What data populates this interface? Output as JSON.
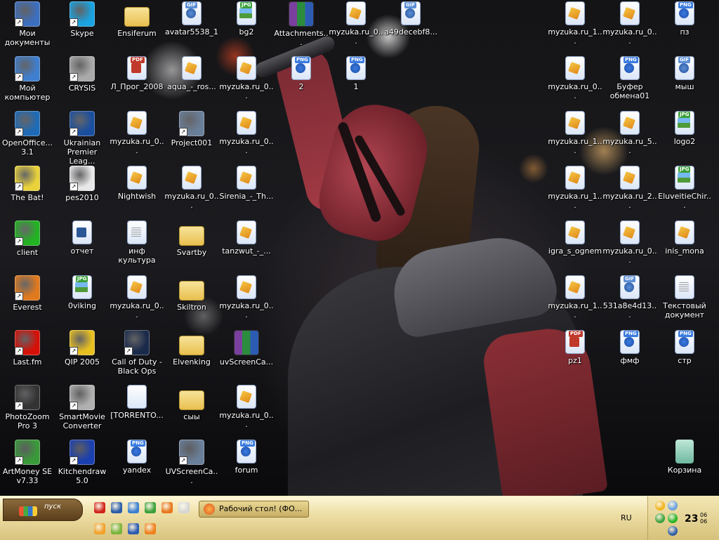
{
  "desktop": {
    "icons": [
      {
        "label": "Мои документы",
        "type": "app",
        "color": "#3c6fbf",
        "name": "my-documents"
      },
      {
        "label": "Skype",
        "type": "app",
        "color": "#1aa3e0",
        "name": "skype"
      },
      {
        "label": "Ensiferum",
        "type": "folder",
        "color": "#e9c04f",
        "name": "ensiferum"
      },
      {
        "label": "avatar5538_1",
        "type": "gif",
        "ext": "GIF",
        "color": "#5c8fd6",
        "name": "avatar5538"
      },
      {
        "label": "bg2",
        "type": "jpg",
        "ext": "JPG",
        "color": "#3aa03a",
        "name": "bg2"
      },
      {
        "label": "Attachments...",
        "type": "rar",
        "color": "#7b3f9e",
        "name": "attachments"
      },
      {
        "label": "myzuka.ru_0...",
        "type": "audio",
        "color": "#f5c542",
        "name": "myzuka-1"
      },
      {
        "label": "a49decebf8...",
        "type": "gif",
        "ext": "GIF",
        "color": "#5c8fd6",
        "name": "a49decebf8"
      },
      {
        "label": "myzuka.ru_1...",
        "type": "audio",
        "color": "#f5c542",
        "name": "myzuka-2"
      },
      {
        "label": "myzuka.ru_0...",
        "type": "audio",
        "color": "#f5c542",
        "name": "myzuka-3"
      },
      {
        "label": "пз",
        "type": "png",
        "ext": "PNG",
        "color": "#3a7be0",
        "name": "pz"
      },
      {
        "label": "Мой компьютер",
        "type": "app",
        "color": "#3f7fd0",
        "name": "my-computer"
      },
      {
        "label": "CRYSIS",
        "type": "app",
        "color": "#aaaaaa",
        "name": "crysis"
      },
      {
        "label": "Л_Прог_2008",
        "type": "pdf",
        "ext": "PDF",
        "color": "#c0392b",
        "name": "l-prog-2008"
      },
      {
        "label": "aqua_-_ros...",
        "type": "audio",
        "color": "#f5c542",
        "name": "aqua-ros"
      },
      {
        "label": "myzuka.ru_0...",
        "type": "audio",
        "color": "#f5c542",
        "name": "myzuka-4"
      },
      {
        "label": "2",
        "type": "png",
        "ext": "PNG",
        "color": "#3a7be0",
        "name": "png-2"
      },
      {
        "label": "1",
        "type": "png",
        "ext": "PNG",
        "color": "#3a7be0",
        "name": "png-1"
      },
      {
        "label": "myzuka.ru_0...",
        "type": "audio",
        "color": "#f5c542",
        "name": "myzuka-5"
      },
      {
        "label": "Буфер обмена01",
        "type": "png",
        "ext": "PNG",
        "color": "#3a7be0",
        "name": "buffer-01"
      },
      {
        "label": "мыш",
        "type": "gif",
        "ext": "GIF",
        "color": "#5c8fd6",
        "name": "mysh"
      },
      {
        "label": "OpenOffice... 3.1",
        "type": "app",
        "color": "#1e6bb8",
        "name": "openoffice"
      },
      {
        "label": "Ukrainian Premier Leag...",
        "type": "app",
        "color": "#1a4fa0",
        "name": "ukrainian-premier-league"
      },
      {
        "label": "myzuka.ru_0...",
        "type": "audio",
        "color": "#f5c542",
        "name": "myzuka-6"
      },
      {
        "label": "Project001",
        "type": "app",
        "color": "#6a7f99",
        "name": "project001"
      },
      {
        "label": "myzuka.ru_0...",
        "type": "audio",
        "color": "#f5c542",
        "name": "myzuka-7"
      },
      {
        "label": "myzuka.ru_1...",
        "type": "audio",
        "color": "#f5c542",
        "name": "myzuka-8"
      },
      {
        "label": "myzuka.ru_5...",
        "type": "audio",
        "color": "#f5c542",
        "name": "myzuka-9"
      },
      {
        "label": "logo2",
        "type": "jpg",
        "ext": "JPG",
        "color": "#3aa03a",
        "name": "logo2"
      },
      {
        "label": "The Bat!",
        "type": "app",
        "color": "#e9d23a",
        "name": "the-bat"
      },
      {
        "label": "pes2010",
        "type": "app",
        "color": "#e8e8e8",
        "name": "pes2010"
      },
      {
        "label": "Nightwish",
        "type": "audio",
        "color": "#f5c542",
        "name": "nightwish"
      },
      {
        "label": "myzuka.ru_0...",
        "type": "audio",
        "color": "#f5c542",
        "name": "myzuka-10"
      },
      {
        "label": "Sirenia_-_Th...",
        "type": "audio",
        "color": "#f5c542",
        "name": "sirenia"
      },
      {
        "label": "myzuka.ru_1...",
        "type": "audio",
        "color": "#f5c542",
        "name": "myzuka-11"
      },
      {
        "label": "myzuka.ru_2...",
        "type": "audio",
        "color": "#f5c542",
        "name": "myzuka-12"
      },
      {
        "label": "EluveitieChir...",
        "type": "jpg",
        "ext": "JPG",
        "color": "#3aa03a",
        "name": "eluveitie"
      },
      {
        "label": "client",
        "type": "app",
        "color": "#22b322",
        "name": "client"
      },
      {
        "label": "отчет",
        "type": "doc",
        "color": "#2b5797",
        "name": "otchet"
      },
      {
        "label": "инф культура",
        "type": "txt",
        "color": "#999999",
        "name": "inf-kultura"
      },
      {
        "label": "Svartby",
        "type": "folder",
        "color": "#e9c04f",
        "name": "svartby"
      },
      {
        "label": "tanzwut_-_...",
        "type": "audio",
        "color": "#f5c542",
        "name": "tanzwut"
      },
      {
        "label": "igra_s_ognem",
        "type": "audio",
        "color": "#f5c542",
        "name": "igra-s-ognem"
      },
      {
        "label": "myzuka.ru_0...",
        "type": "audio",
        "color": "#f5c542",
        "name": "myzuka-13"
      },
      {
        "label": "inis_mona",
        "type": "audio",
        "color": "#f5c542",
        "name": "inis-mona"
      },
      {
        "label": "Everest",
        "type": "app",
        "color": "#e07a1e",
        "name": "everest"
      },
      {
        "label": "0viking",
        "type": "jpg",
        "ext": "JPG",
        "color": "#3aa03a",
        "name": "0viking"
      },
      {
        "label": "myzuka.ru_0...",
        "type": "audio",
        "color": "#f5c542",
        "name": "myzuka-14"
      },
      {
        "label": "Skiltron",
        "type": "folder",
        "color": "#e9c04f",
        "name": "skiltron"
      },
      {
        "label": "myzuka.ru_0...",
        "type": "audio",
        "color": "#f5c542",
        "name": "myzuka-15"
      },
      {
        "label": "myzuka.ru_1...",
        "type": "audio",
        "color": "#f5c542",
        "name": "myzuka-16"
      },
      {
        "label": "531a8e4d13...",
        "type": "gif",
        "ext": "GIF",
        "color": "#5c8fd6",
        "name": "531a8e4d13"
      },
      {
        "label": "Текстовый документ",
        "type": "txt",
        "color": "#999999",
        "name": "text-document"
      },
      {
        "label": "Last.fm",
        "type": "app",
        "color": "#d51007",
        "name": "lastfm"
      },
      {
        "label": "QIP 2005",
        "type": "app",
        "color": "#e8c020",
        "name": "qip-2005"
      },
      {
        "label": "Call of Duty - Black Ops",
        "type": "app",
        "color": "#1a2a4a",
        "name": "call-of-duty"
      },
      {
        "label": "Elvenking",
        "type": "folder",
        "color": "#e9c04f",
        "name": "elvenking"
      },
      {
        "label": "uvScreenCa...",
        "type": "rar",
        "color": "#7b3f9e",
        "name": "uvscreencamera-rar"
      },
      {
        "label": "pz1",
        "type": "pdf",
        "ext": "PDF",
        "color": "#c0392b",
        "name": "pz1"
      },
      {
        "label": "фмф",
        "type": "png",
        "ext": "PNG",
        "color": "#3a7be0",
        "name": "fmf"
      },
      {
        "label": "стр",
        "type": "png",
        "ext": "PNG",
        "color": "#3a7be0",
        "name": "str"
      },
      {
        "label": "PhotoZoom Pro 3",
        "type": "app",
        "color": "#333333",
        "name": "photozoom"
      },
      {
        "label": "SmartMovie Converter",
        "type": "app",
        "color": "#b0b0b0",
        "name": "smartmovie"
      },
      {
        "label": "[TORRENTO...",
        "type": "blank",
        "color": "#ffffff",
        "name": "torrento"
      },
      {
        "label": "сыы",
        "type": "folder",
        "color": "#e9c04f",
        "name": "syy"
      },
      {
        "label": "myzuka.ru_0...",
        "type": "audio",
        "color": "#f5c542",
        "name": "myzuka-17"
      },
      {
        "label": "ArtMoney SE v7.33",
        "type": "app",
        "color": "#3a9a3a",
        "name": "artmoney"
      },
      {
        "label": "Kitchendraw 5.0",
        "type": "app",
        "color": "#1a3fb0",
        "name": "kitchendraw"
      },
      {
        "label": "yandex",
        "type": "png",
        "ext": "PNG",
        "color": "#3a7be0",
        "name": "yandex"
      },
      {
        "label": "UVScreenCa...",
        "type": "app",
        "color": "#6a7f99",
        "name": "uvscreencamera"
      },
      {
        "label": "forum",
        "type": "png",
        "ext": "PNG",
        "color": "#3a7be0",
        "name": "forum"
      },
      {
        "label": "Корзина",
        "type": "trash",
        "color": "#6fb9a0",
        "name": "recycle-bin"
      }
    ]
  },
  "taskbar": {
    "start_label": "пуск",
    "quick_launch": [
      {
        "name": "opera",
        "color": "#d0241b"
      },
      {
        "name": "save",
        "color": "#2b5ca8"
      },
      {
        "name": "media-player",
        "color": "#3c7fd0"
      },
      {
        "name": "icq",
        "color": "#3aa03a"
      },
      {
        "name": "firefox",
        "color": "#e8761c"
      },
      {
        "name": "abbyy",
        "color": "#d6d6d6"
      },
      {
        "name": "avast",
        "color": "#f2a12a"
      },
      {
        "name": "torrent",
        "color": "#7ab43a"
      },
      {
        "name": "winamp",
        "color": "#2c5bb4"
      },
      {
        "name": "aimp",
        "color": "#f0801a"
      }
    ],
    "task_button": "Рабочий стол! (ФО...",
    "language": "RU",
    "clock": "23",
    "clock_sub_top": "06",
    "clock_sub_bottom": "06",
    "tray": [
      {
        "name": "tray-1",
        "color": "#f2b21a"
      },
      {
        "name": "tray-2",
        "color": "#6aa0e0"
      },
      {
        "name": "tray-3",
        "color": "#3aa03a"
      },
      {
        "name": "tray-4",
        "color": "#22b322"
      },
      {
        "name": "tray-5",
        "color": "#2b5ca8"
      }
    ]
  }
}
